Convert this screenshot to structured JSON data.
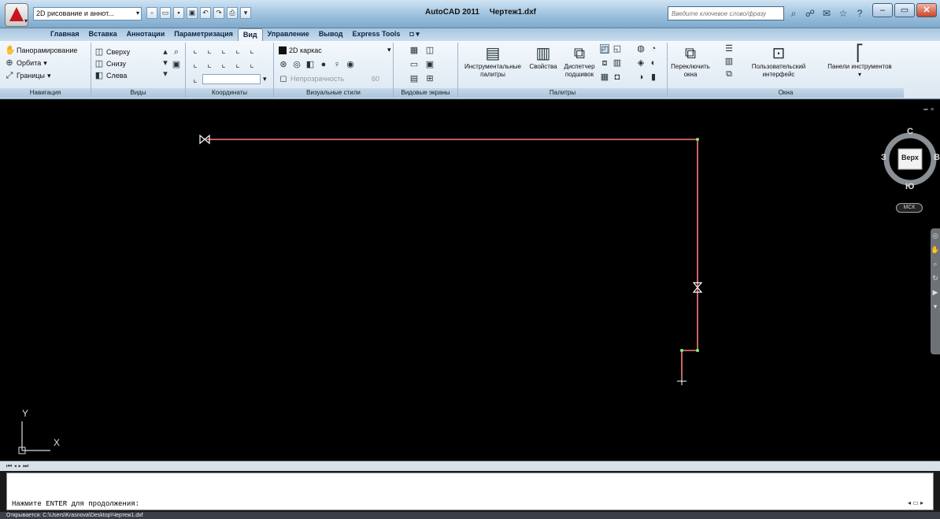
{
  "title_bar": {
    "workspace": "2D рисование и аннот...",
    "app_name": "AutoCAD 2011",
    "file_name": "Чертеж1.dxf",
    "search_placeholder": "Введите ключевое слово/фразу"
  },
  "tabs": [
    "Главная",
    "Вставка",
    "Аннотации",
    "Параметризация",
    "Вид",
    "Управление",
    "Вывод",
    "Express Tools"
  ],
  "active_tab": "Вид",
  "ribbon": {
    "navigation": {
      "title": "Навигация",
      "items": [
        "Панорамирование",
        "Орбита",
        "Границы"
      ]
    },
    "views": {
      "title": "Виды",
      "items": [
        "Сверху",
        "Снизу",
        "Слева"
      ]
    },
    "coordinates": {
      "title": "Координаты"
    },
    "visual_styles": {
      "title": "Визуальные стили",
      "current": "2D каркас",
      "transparency_label": "Непрозрачность",
      "transparency_value": "60"
    },
    "viewports": {
      "title": "Видовые экраны"
    },
    "palettes": {
      "title": "Палитры",
      "tool_palettes": "Инструментальные палитры",
      "properties": "Свойства",
      "sheet_set_manager": "Диспетчер подшивок"
    },
    "windows": {
      "title": "Окна",
      "switch_windows": "Переключить окна",
      "user_interface": "Пользовательский интерфейс",
      "toolbars": "Панели инструментов"
    }
  },
  "viewcube": {
    "north": "С",
    "south": "Ю",
    "west": "З",
    "east": "В",
    "face": "Верх",
    "wcs": "МСК"
  },
  "ucs": {
    "x": "X",
    "y": "Y"
  },
  "command_line": {
    "prompt": "Нажмите ENTER для продолжения:"
  },
  "status": "Открывается: C:\\Users\\Krasnova\\Desktop\\Чертеж1.dxf",
  "colors": {
    "pipe": "#ff7a7a",
    "canvas": "#000000",
    "ribbon": "#dbe7f2"
  }
}
